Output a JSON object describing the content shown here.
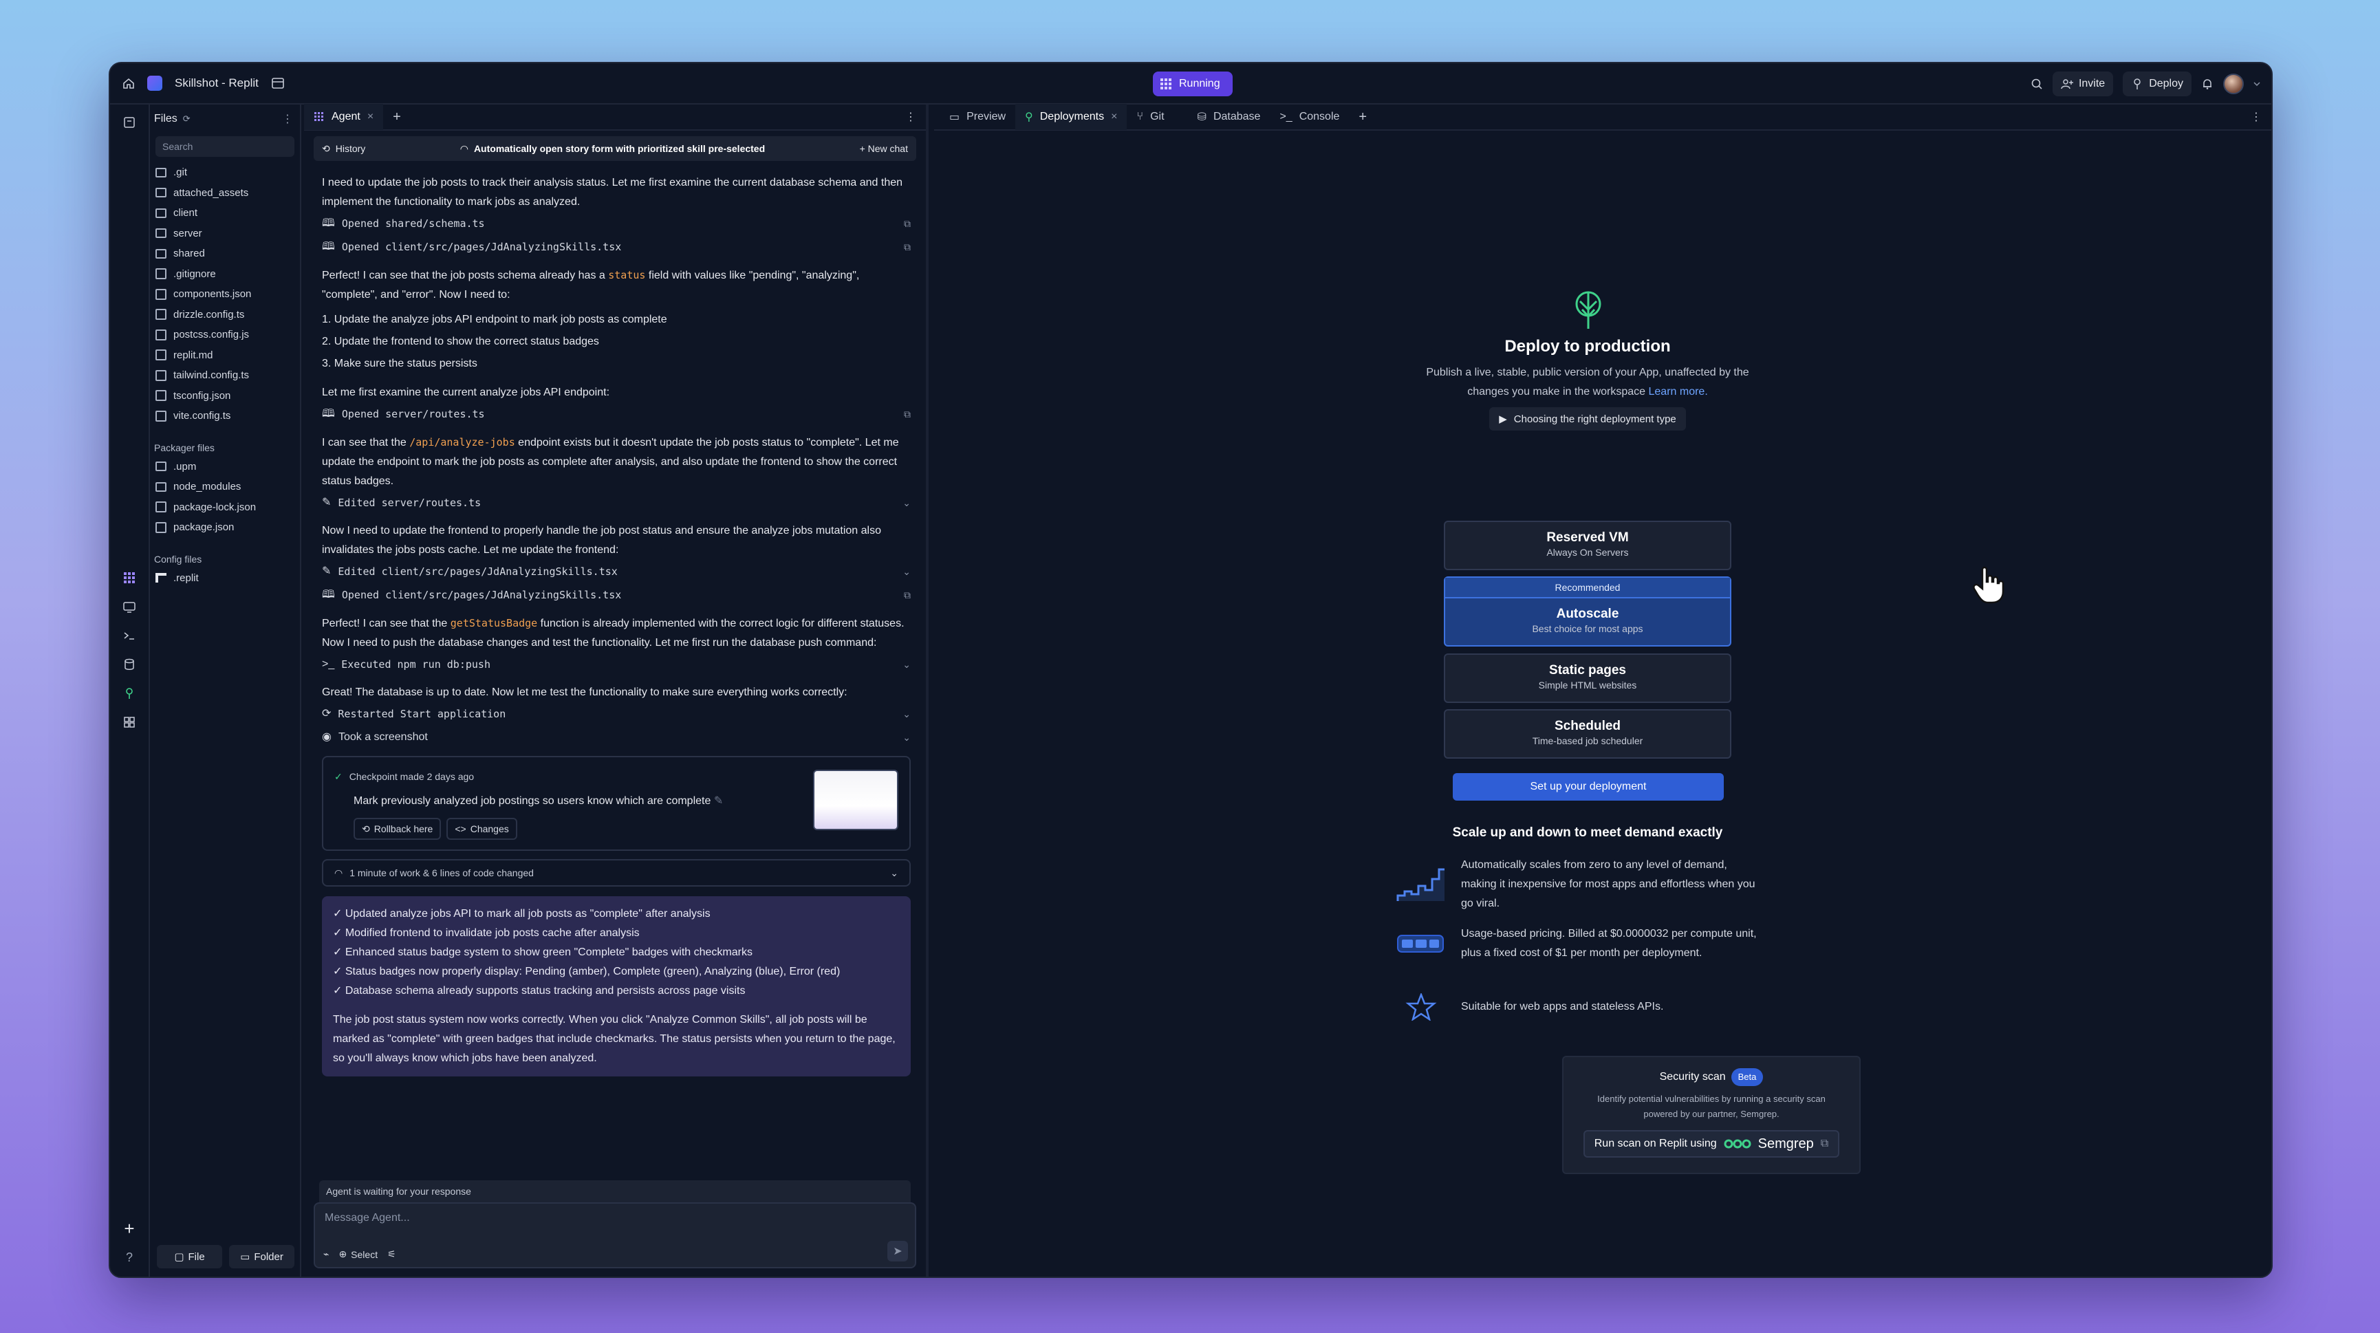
{
  "topbar": {
    "project_name": "Skillshot - Replit",
    "status": "Running",
    "invite_label": "Invite",
    "deploy_label": "Deploy"
  },
  "files": {
    "header": "Files",
    "search_placeholder": "Search",
    "items": [
      ".git",
      "attached_assets",
      "client",
      "server",
      "shared",
      ".gitignore",
      "components.json",
      "drizzle.config.ts",
      "postcss.config.js",
      "replit.md",
      "tailwind.config.ts",
      "tsconfig.json",
      "vite.config.ts"
    ],
    "packager_label": "Packager files",
    "packager_items": [
      ".upm",
      "node_modules",
      "package-lock.json",
      "package.json"
    ],
    "config_label": "Config files",
    "config_items": [
      ".replit"
    ],
    "file_button": "File",
    "folder_button": "Folder"
  },
  "agent": {
    "tab_label": "Agent",
    "history_label": "History",
    "task_title": "Automatically open story form with prioritized skill pre-selected",
    "new_chat_label": "+ New chat",
    "msg1": "I need to update the job posts to track their analysis status. Let me first examine the current database schema and then implement the functionality to mark jobs as analyzed.",
    "step_opened_1": "Opened shared/schema.ts",
    "step_opened_2": "Opened client/src/pages/JdAnalyzingSkills.tsx",
    "msg2_a": "Perfect! I can see that the job posts schema already has a ",
    "msg2_code": "status",
    "msg2_b": " field with values like \"pending\", \"analyzing\", \"complete\", and \"error\". Now I need to:",
    "todo": [
      "1. Update the analyze jobs API endpoint to mark job posts as complete",
      "2. Update the frontend to show the correct status badges",
      "3. Make sure the status persists"
    ],
    "msg3": "Let me first examine the current analyze jobs API endpoint:",
    "step_opened_3": "Opened server/routes.ts",
    "msg4_a": "I can see that the ",
    "msg4_code": "/api/analyze-jobs",
    "msg4_b": " endpoint exists but it doesn't update the job posts status to \"complete\". Let me update the endpoint to mark the job posts as complete after analysis, and also update the frontend to show the correct status badges.",
    "step_edited_1": "Edited server/routes.ts",
    "msg5": "Now I need to update the frontend to properly handle the job post status and ensure the analyze jobs mutation also invalidates the jobs posts cache. Let me update the frontend:",
    "step_edited_2": "Edited client/src/pages/JdAnalyzingSkills.tsx",
    "step_opened_4": "Opened client/src/pages/JdAnalyzingSkills.tsx",
    "msg6_a": "Perfect! I can see that the ",
    "msg6_code": "getStatusBadge",
    "msg6_b": " function is already implemented with the correct logic for different statuses. Now I need to push the database changes and test the functionality. Let me first run the database push command:",
    "step_exec": "Executed npm run db:push",
    "msg7": "Great! The database is up to date. Now let me test the functionality to make sure everything works correctly:",
    "step_restart": "Restarted Start application",
    "step_screenshot": "Took a screenshot",
    "checkpoint_title": "Checkpoint made 2 days ago",
    "checkpoint_desc": "Mark previously analyzed job postings so users know which are complete",
    "rollback_label": "Rollback here",
    "changes_label": "Changes",
    "work_summary": "1 minute of work & 6 lines of code changed",
    "summary_items": [
      "✓ Updated analyze jobs API to mark all job posts as \"complete\" after analysis",
      "✓ Modified frontend to invalidate job posts cache after analysis",
      "✓ Enhanced status badge system to show green \"Complete\" badges with checkmarks",
      "✓ Status badges now properly display: Pending (amber), Complete (green), Analyzing (blue), Error (red)",
      "✓ Database schema already supports status tracking and persists across page visits"
    ],
    "summary_text": "The job post status system now works correctly. When you click \"Analyze Common Skills\", all job posts will be marked as \"complete\" with green badges that include checkmarks. The status persists when you return to the page, so you'll always know which jobs have been analyzed.",
    "waiting_text": "Agent is waiting for your response",
    "input_placeholder": "Message Agent...",
    "select_label": "Select"
  },
  "right_tabs": [
    "Preview",
    "Deployments",
    "Git",
    "Database",
    "Console"
  ],
  "deploy": {
    "title": "Deploy to production",
    "desc_a": "Publish a live, stable, public version of your App, unaffected by the changes you make in the workspace ",
    "learn_more": "Learn more.",
    "video_chip": "Choosing the right deployment type",
    "options": [
      {
        "title": "Reserved VM",
        "sub": "Always On Servers"
      },
      {
        "title": "Autoscale",
        "sub": "Best choice for most apps",
        "badge": "Recommended"
      },
      {
        "title": "Static pages",
        "sub": "Simple HTML websites"
      },
      {
        "title": "Scheduled",
        "sub": "Time-based job scheduler"
      }
    ],
    "cta": "Set up your deployment",
    "scale_title": "Scale up and down to meet demand exactly",
    "features": [
      "Automatically scales from zero to any level of demand, making it inexpensive for most apps and effortless when you go viral.",
      "Usage-based pricing. Billed at $0.0000032 per compute unit, plus a fixed cost of $1 per month per deployment.",
      "Suitable for web apps and stateless APIs."
    ],
    "scan_title": "Security scan",
    "scan_badge": "Beta",
    "scan_desc": "Identify potential vulnerabilities by running a security scan powered by our partner, Semgrep.",
    "scan_button": "Run scan on Replit using",
    "scan_brand": "Semgrep"
  },
  "colors": {
    "accent": "#5b3ee0",
    "primary_blue": "#2f5ed6",
    "bg": "#0e1525"
  }
}
